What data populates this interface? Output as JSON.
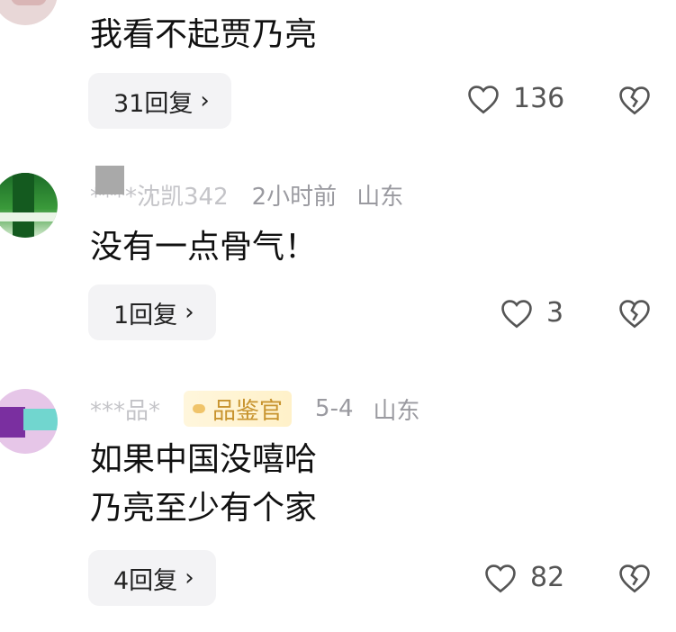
{
  "comments": [
    {
      "username": "",
      "time": "",
      "location": "",
      "text": "我看不起贾乃亮",
      "reply_label": "31回复",
      "likes": "136"
    },
    {
      "username": "****沈凯342",
      "time": "2小时前",
      "location": "山东",
      "text": "没有一点骨气！",
      "reply_label": "1回复",
      "likes": "3"
    },
    {
      "username": "***品*",
      "badge": "品鉴官",
      "time": "5-4",
      "location": "山东",
      "text_lines": [
        "如果中国没嘻哈",
        "乃亮至少有个家"
      ],
      "reply_label": "4回复",
      "likes": "82"
    }
  ],
  "icons": {
    "like": "heart-outline-icon",
    "dislike": "broken-heart-icon",
    "chevron": "chevron-right-icon"
  }
}
